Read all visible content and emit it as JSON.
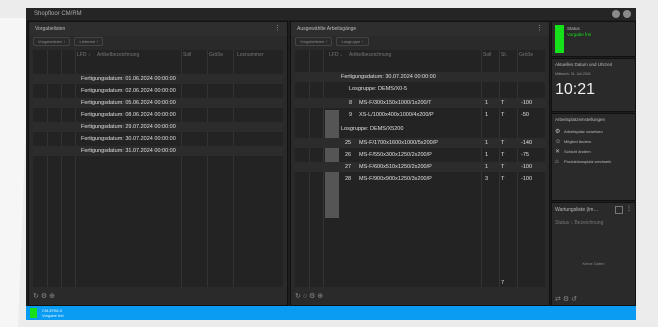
{
  "app": {
    "title": "Shopfloor CM/RM"
  },
  "left_panel": {
    "title": "Vorgabelisten",
    "chips": [
      "Vorgabelisten ↑",
      "Lieferant ↑"
    ],
    "columns": [
      "LFD ↓",
      "Artikelbezeichnung",
      "Soll",
      "Größe",
      "Losnummer"
    ],
    "rows": [
      "Fertigungsdatum: 01.06.2024 00:00:00",
      "Fertigungsdatum: 02.06.2024 00:00:00",
      "Fertigungsdatum: 05.06.2024 00:00:00",
      "Fertigungsdatum: 08.06.2024 00:00:00",
      "Fertigungsdatum: 29.07.2024 00:00:00",
      "Fertigungsdatum: 30.07.2024 00:00:00",
      "Fertigungsdatum: 31.07.2024 00:00:00"
    ]
  },
  "mid_panel": {
    "title": "Ausgewählte Arbeitsgänge",
    "chips": [
      "Vorgabelisten ↑",
      "Losgruppe ↑"
    ],
    "columns": [
      "LFD ↓",
      "Artikelbezeichnung",
      "Soll",
      "St.",
      "Größe"
    ],
    "group1": "Fertigungsdatum: 30.07.2024 00:00:00",
    "group2": "Losgruppe: DEMS/X0-5",
    "group3": "Losgruppe: DEMS/X5200",
    "items": [
      {
        "lfd": "8",
        "name": "MS-F/300x150x1000/1x200/T",
        "soll": "1",
        "st": "T",
        "size": "-100"
      },
      {
        "lfd": "9",
        "name": "XS-L/1000x400x1000/4x200/P",
        "soll": "1",
        "st": "T",
        "size": "-50"
      },
      {
        "lfd": "25",
        "name": "MS-F/1700x1600x1000/5x200/P",
        "soll": "1",
        "st": "T",
        "size": "-140"
      },
      {
        "lfd": "26",
        "name": "MS-F/550x300x1250/2x200/P",
        "soll": "1",
        "st": "T",
        "size": "-75"
      },
      {
        "lfd": "27",
        "name": "MS-F/600x510x1250/2x200/P",
        "soll": "1",
        "st": "T",
        "size": "-100"
      },
      {
        "lfd": "28",
        "name": "MS-F/900x900x1250/3x200/P",
        "soll": "3",
        "st": "T",
        "size": "-100"
      }
    ],
    "footer_count": "7"
  },
  "status_tile": {
    "label": "Status",
    "sub": "Vorgabe frei"
  },
  "clock": {
    "title": "Aktuelles Datum und Uhrzeit",
    "date": "Mittwoch, 31. Juli 2024",
    "time": "10:21"
  },
  "settings": {
    "title": "Arbeitsplatzeinstellungen",
    "items": [
      "Arbeitsplatz zuweisen",
      "Mitglied ändern",
      "Schicht ändern",
      "Produktionsplatz wechseln"
    ]
  },
  "maintenance": {
    "title": "Wartungsliste (im…",
    "columns": "Status ↓ Bezeichnung",
    "empty": "Keine Daten"
  },
  "statusbar": {
    "line1": "CM-ERM-3",
    "line2": "Vorgabe frei"
  },
  "colors": {
    "accent_green": "#16e01a",
    "statusbar_blue": "#0a9cf2"
  }
}
